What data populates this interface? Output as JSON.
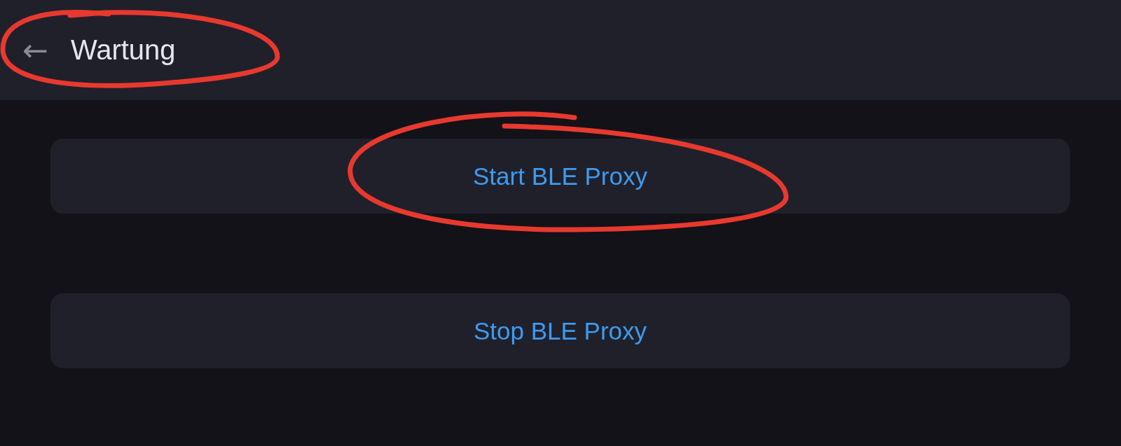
{
  "header": {
    "back_icon": "←",
    "title": "Wartung"
  },
  "buttons": [
    {
      "label": "Start BLE Proxy"
    },
    {
      "label": "Stop BLE Proxy"
    }
  ]
}
